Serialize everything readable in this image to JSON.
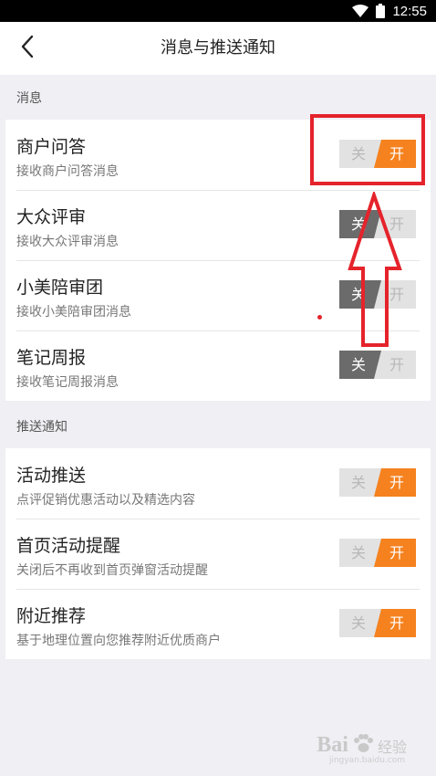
{
  "status_bar": {
    "time": "12:55"
  },
  "nav": {
    "title": "消息与推送通知"
  },
  "sections": [
    {
      "header": "消息",
      "rows": [
        {
          "title": "商户问答",
          "subtitle": "接收商户问答消息",
          "toggle": {
            "off_label": "关",
            "on_label": "开",
            "state": "on"
          }
        },
        {
          "title": "大众评审",
          "subtitle": "接收大众评审消息",
          "toggle": {
            "off_label": "关",
            "on_label": "开",
            "state": "off"
          }
        },
        {
          "title": "小美陪审团",
          "subtitle": "接收小美陪审团消息",
          "toggle": {
            "off_label": "关",
            "on_label": "开",
            "state": "off"
          }
        },
        {
          "title": "笔记周报",
          "subtitle": "接收笔记周报消息",
          "toggle": {
            "off_label": "关",
            "on_label": "开",
            "state": "off"
          }
        }
      ]
    },
    {
      "header": "推送通知",
      "rows": [
        {
          "title": "活动推送",
          "subtitle": "点评促销优惠活动以及精选内容",
          "toggle": {
            "off_label": "关",
            "on_label": "开",
            "state": "on"
          }
        },
        {
          "title": "首页活动提醒",
          "subtitle": "关闭后不再收到首页弹窗活动提醒",
          "toggle": {
            "off_label": "关",
            "on_label": "开",
            "state": "on"
          }
        },
        {
          "title": "附近推荐",
          "subtitle": "基于地理位置向您推荐附近优质商户",
          "toggle": {
            "off_label": "关",
            "on_label": "开",
            "state": "on"
          }
        }
      ]
    }
  ],
  "colors": {
    "toggle_on": "#f5821f",
    "toggle_off_dark": "#6b6b6b",
    "toggle_inactive": "#e2e2e2",
    "annotation": "#e5232b",
    "background": "#efeff4"
  },
  "watermark": {
    "logo": "Bai",
    "text": "经验",
    "sub": "jingyan.baidu.com"
  }
}
